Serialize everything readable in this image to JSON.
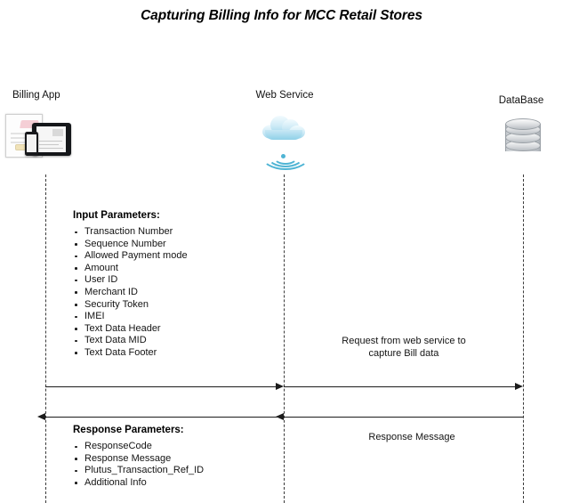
{
  "title": "Capturing Billing Info for MCC\nRetail Stores",
  "actors": [
    {
      "id": "billing-app",
      "label": "Billing App",
      "icon": "billing-app-devices-icon"
    },
    {
      "id": "web-service",
      "label": "Web Service",
      "icon": "cloud-wifi-icon"
    },
    {
      "id": "database",
      "label": "DataBase",
      "icon": "database-cylinder-icon"
    }
  ],
  "input_parameters": {
    "heading": "Input Parameters:",
    "items": [
      "Transaction Number",
      "Sequence Number",
      "Allowed Payment mode",
      "Amount",
      "User ID",
      "Merchant ID",
      "Security Token",
      "IMEI",
      "Text Data Header",
      "Text Data MID",
      "Text Data Footer"
    ]
  },
  "response_parameters": {
    "heading": "Response Parameters:",
    "items": [
      "ResponseCode",
      "Response Message",
      "Plutus_Transaction_Ref_ID",
      "Additional Info"
    ]
  },
  "messages": [
    {
      "id": "request-to-database",
      "label": "Request from web service to\ncapture Bill data",
      "from": "web-service",
      "to": "database",
      "direction": "right"
    },
    {
      "id": "response-message",
      "label": "Response Message",
      "from": "database",
      "to": "web-service",
      "direction": "left"
    }
  ],
  "colors": {
    "background": "#ffffff",
    "line": "#1c1c1c",
    "lifeline": "#3a3a3a",
    "cloud": "#9ed6ec",
    "wifi": "#4fb4d4",
    "database": "#c3c8cd",
    "text": "#141414"
  }
}
